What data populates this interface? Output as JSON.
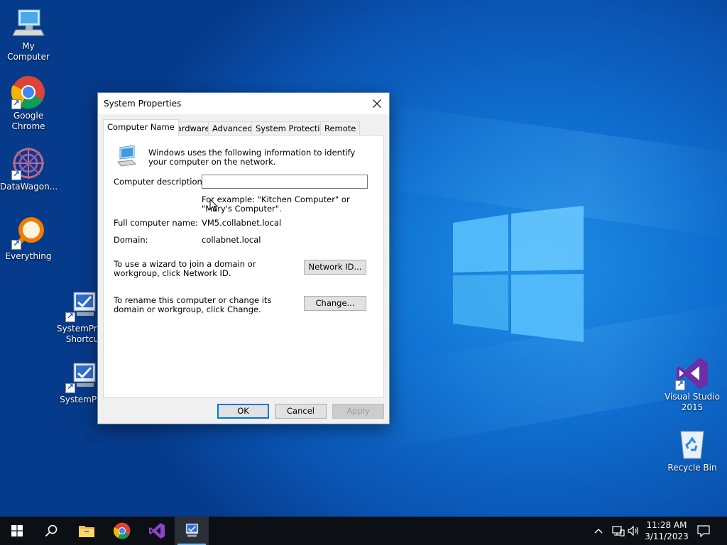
{
  "desktop": {
    "icons": [
      {
        "label": "My Computer"
      },
      {
        "label": "Google Chrome"
      },
      {
        "label": "DataWagon..."
      },
      {
        "label": "Everything"
      },
      {
        "label": "SystemPro - Shortcu"
      },
      {
        "label": "SystemPro"
      },
      {
        "label": "Visual Studio 2015"
      },
      {
        "label": "Recycle Bin"
      }
    ]
  },
  "dialog": {
    "title": "System Properties",
    "tabs": [
      "Computer Name",
      "Hardware",
      "Advanced",
      "System Protection",
      "Remote"
    ],
    "active_tab": "Computer Name",
    "intro": "Windows uses the following information to identify your computer on the network.",
    "description_label": "Computer description:",
    "description_value": "",
    "example": "For example: \"Kitchen Computer\" or \"Mary's Computer\".",
    "full_name_label": "Full computer name:",
    "full_name_value": "VM5.collabnet.local",
    "domain_label": "Domain:",
    "domain_value": "collabnet.local",
    "wizard_text": "To use a wizard to join a domain or workgroup, click Network ID.",
    "network_id_button": "Network ID...",
    "rename_text": "To rename this computer or change its domain or workgroup, click Change.",
    "change_button": "Change...",
    "ok_button": "OK",
    "cancel_button": "Cancel",
    "apply_button": "Apply"
  },
  "taskbar": {
    "apps": [
      "start-icon",
      "search-icon",
      "file-explorer-icon",
      "chrome-icon",
      "visual-studio-icon",
      "system-properties-icon"
    ],
    "time": "11:28 AM",
    "date": "3/11/2023"
  },
  "colors": {
    "accent": "#0078d7",
    "desktop_blue": "#0a52b0",
    "taskbar": "#0c0f14"
  }
}
